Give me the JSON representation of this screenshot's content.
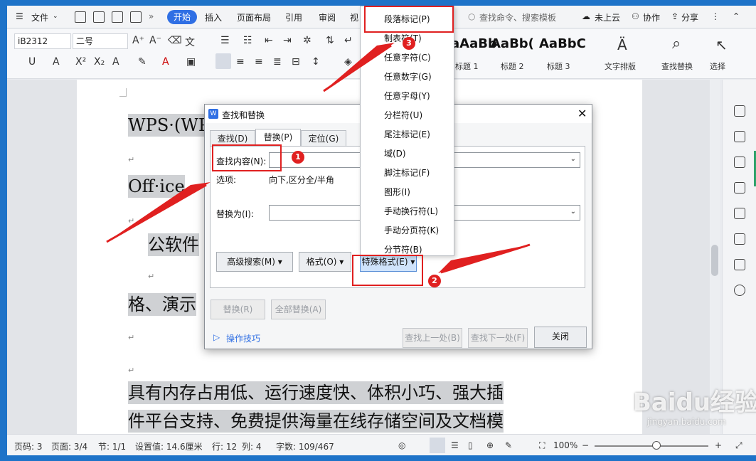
{
  "menubar": {
    "file_label": "文件",
    "tabs": [
      "开始",
      "插入",
      "页面布局",
      "引用",
      "审阅",
      "视"
    ],
    "search_placeholder": "查找命令、搜索模板",
    "cloud_label": "未上云",
    "collab_label": "协作",
    "share_label": "分享"
  },
  "ribbon": {
    "font_name": "iB2312",
    "font_size": "二号",
    "styles": [
      {
        "preview": "aAaBb",
        "label": "标题 1"
      },
      {
        "preview": "AaBb(",
        "label": "标题 2"
      },
      {
        "preview": "AaBbC",
        "label": "标题 3"
      }
    ],
    "text_layout_label": "文字排版",
    "find_replace_label": "查找替换",
    "select_label": "选择"
  },
  "document": {
    "lines": [
      "WPS·(WPS",
      "Off·ice",
      "公软件",
      "格、演示",
      "具有内存占用低、运行速度快、体积小巧、强大插",
      "件平台支持、免费提供海量在线存储空间及文档模"
    ],
    "para_mark": "↵"
  },
  "dialog": {
    "title": "查找和替换",
    "tabs": [
      "查找(D)",
      "替换(P)",
      "定位(G)"
    ],
    "find_label": "查找内容(N):",
    "find_value": "",
    "options_label": "选项:",
    "options_value": "向下,区分全/半角",
    "replace_label": "替换为(I):",
    "replace_value": "",
    "advanced_button": "高级搜索(M)",
    "format_button": "格式(O)",
    "special_button": "特殊格式(E)",
    "replace_button": "替换(R)",
    "replace_all_button": "全部替换(A)",
    "tips_label": "操作技巧",
    "find_prev_button": "查找上一处(B)",
    "find_next_button": "查找下一处(F)",
    "close_button": "关闭"
  },
  "special_menu": {
    "items": [
      "段落标记(P)",
      "制表符(T)",
      "任意字符(C)",
      "任意数字(G)",
      "任意字母(Y)",
      "分栏符(U)",
      "尾注标记(E)",
      "域(D)",
      "脚注标记(F)",
      "图形(I)",
      "手动换行符(L)",
      "手动分页符(K)",
      "分节符(B)"
    ]
  },
  "annotations": {
    "badge1": "1",
    "badge2": "2",
    "badge3": "3",
    "color": "#e02020"
  },
  "statusbar": {
    "page_num": "页码: 3",
    "pages": "页面: 3/4",
    "section": "节: 1/1",
    "setting": "设置值: 14.6厘米",
    "row": "行: 12",
    "col": "列: 4",
    "words": "字数: 109/467",
    "zoom": "100%"
  },
  "watermark": {
    "text": "Baidu经验",
    "url": "jingyan.baidu.com"
  }
}
